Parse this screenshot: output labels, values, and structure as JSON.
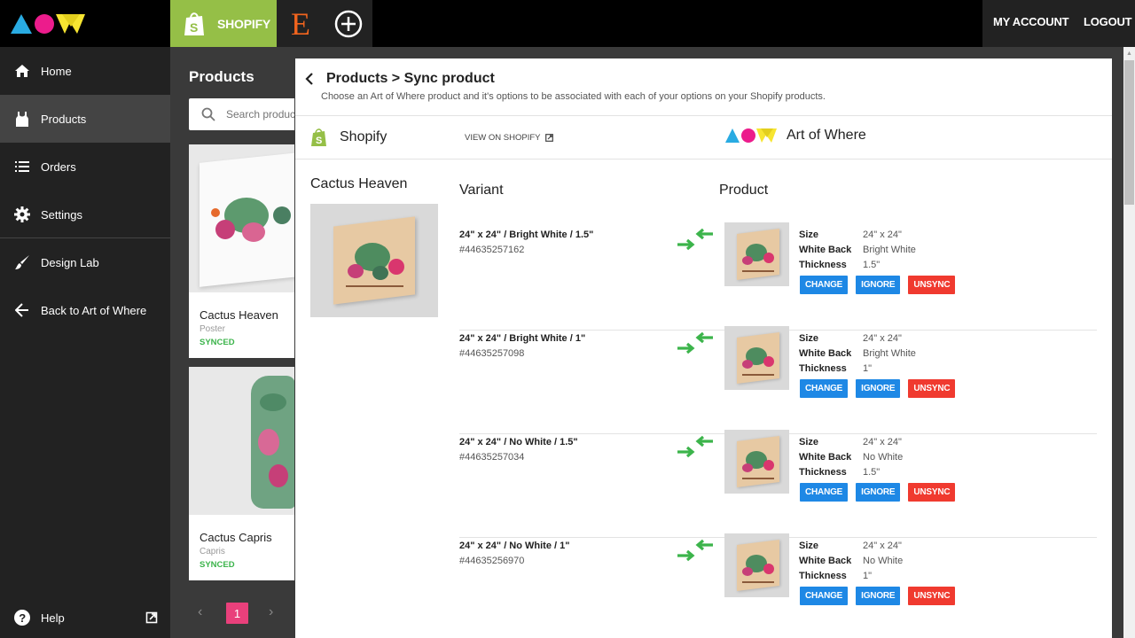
{
  "topbar": {
    "logo_alt": "Art of Where logo",
    "tabs": [
      {
        "label": "SHOPIFY",
        "icon": "shopify-bag-icon",
        "active": true,
        "color": "#95bf47"
      },
      {
        "label": "E",
        "icon": "etsy-icon",
        "active": false,
        "color": "#f1641e"
      },
      {
        "label": "",
        "icon": "add-store-icon",
        "active": false
      }
    ],
    "my_account": "MY ACCOUNT",
    "logout": "LOGOUT"
  },
  "sidebar": {
    "items": [
      {
        "label": "Home",
        "icon": "home-icon",
        "active": false
      },
      {
        "label": "Products",
        "icon": "tank-top-icon",
        "active": true
      },
      {
        "label": "Orders",
        "icon": "list-icon",
        "active": false
      },
      {
        "label": "Settings",
        "icon": "gear-icon",
        "active": false
      },
      {
        "label": "Design Lab",
        "icon": "brush-icon",
        "active": false
      },
      {
        "label": "Back to Art of Where",
        "icon": "arrow-left-icon",
        "active": false
      }
    ],
    "help": {
      "label": "Help",
      "icon": "help-icon",
      "ext_icon": "external-link-icon"
    }
  },
  "product_list": {
    "title": "Products",
    "search_placeholder": "Search products",
    "cards": [
      {
        "name": "Cactus Heaven",
        "type": "Poster",
        "status": "SYNCED"
      },
      {
        "name": "Cactus Capris",
        "type": "Capris",
        "status": "SYNCED"
      }
    ],
    "pagination": {
      "current": "1",
      "prev": "‹",
      "next": "›"
    }
  },
  "main": {
    "breadcrumb": "Products > Sync product",
    "subtitle": "Choose an Art of Where product and it's options to be associated with each of your options on your Shopify products.",
    "shopify_label": "Shopify",
    "view_on_shopify": "VIEW ON SHOPIFY",
    "aow_label": "Art of Where",
    "product_name": "Cactus Heaven",
    "variant_header": "Variant",
    "product_header": "Product",
    "attr_labels": {
      "size": "Size",
      "white_back": "White Back",
      "thickness": "Thickness"
    },
    "buttons": {
      "change": "CHANGE",
      "ignore": "IGNORE",
      "unsync": "UNSYNC"
    },
    "variants": [
      {
        "name": "24\" x 24\" / Bright White / 1.5\"",
        "id": "#44635257162",
        "size": "24\" x 24\"",
        "white_back": "Bright White",
        "thickness": "1.5\""
      },
      {
        "name": "24\" x 24\" / Bright White / 1\"",
        "id": "#44635257098",
        "size": "24\" x 24\"",
        "white_back": "Bright White",
        "thickness": "1\""
      },
      {
        "name": "24\" x 24\" / No White / 1.5\"",
        "id": "#44635257034",
        "size": "24\" x 24\"",
        "white_back": "No White",
        "thickness": "1.5\""
      },
      {
        "name": "24\" x 24\" / No White / 1\"",
        "id": "#44635256970",
        "size": "24\" x 24\"",
        "white_back": "No White",
        "thickness": "1\""
      }
    ]
  },
  "colors": {
    "accent_pink": "#e9407b",
    "synced_green": "#3cb44b",
    "button_blue": "#1e88e5",
    "button_red": "#f03a2f",
    "shopify_green": "#95bf47",
    "sync_arrow_green": "#3cb44b"
  }
}
